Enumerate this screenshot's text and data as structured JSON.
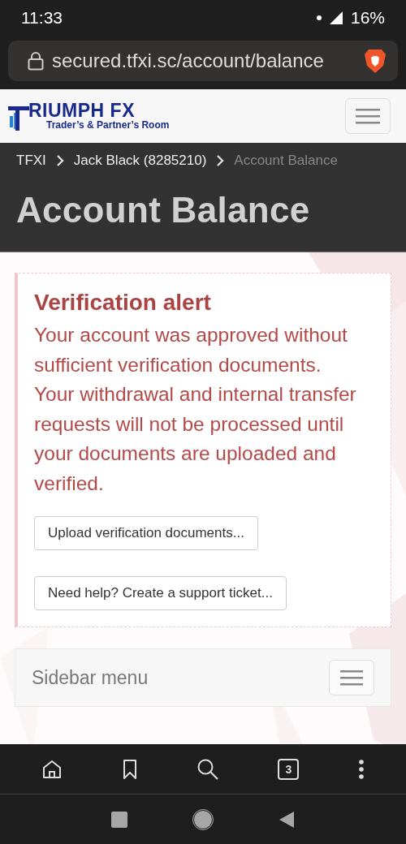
{
  "status_bar": {
    "time": "11:33",
    "battery": "16%"
  },
  "address_bar": {
    "url": "secured.tfxi.sc/account/balance"
  },
  "site_header": {
    "logo_title": "RIUMPH FX",
    "logo_subtitle": "Trader’s & Partner’s Room"
  },
  "breadcrumb": [
    {
      "label": "TFXI",
      "current": false
    },
    {
      "label": "Jack Black (8285210)",
      "current": false
    },
    {
      "label": "Account Balance",
      "current": true
    }
  ],
  "page_title": "Account Balance",
  "alert": {
    "title": "Verification alert",
    "paragraphs": [
      "Your account was approved without sufficient verification documents.",
      "Your withdrawal and internal transfer requests will not be processed until your documents are uploaded and verified."
    ],
    "buttons": [
      "Upload verification documents...",
      "Need help? Create a support ticket..."
    ]
  },
  "sidebar": {
    "title": "Sidebar menu"
  },
  "browser_toolbar": {
    "tab_count": "3"
  }
}
